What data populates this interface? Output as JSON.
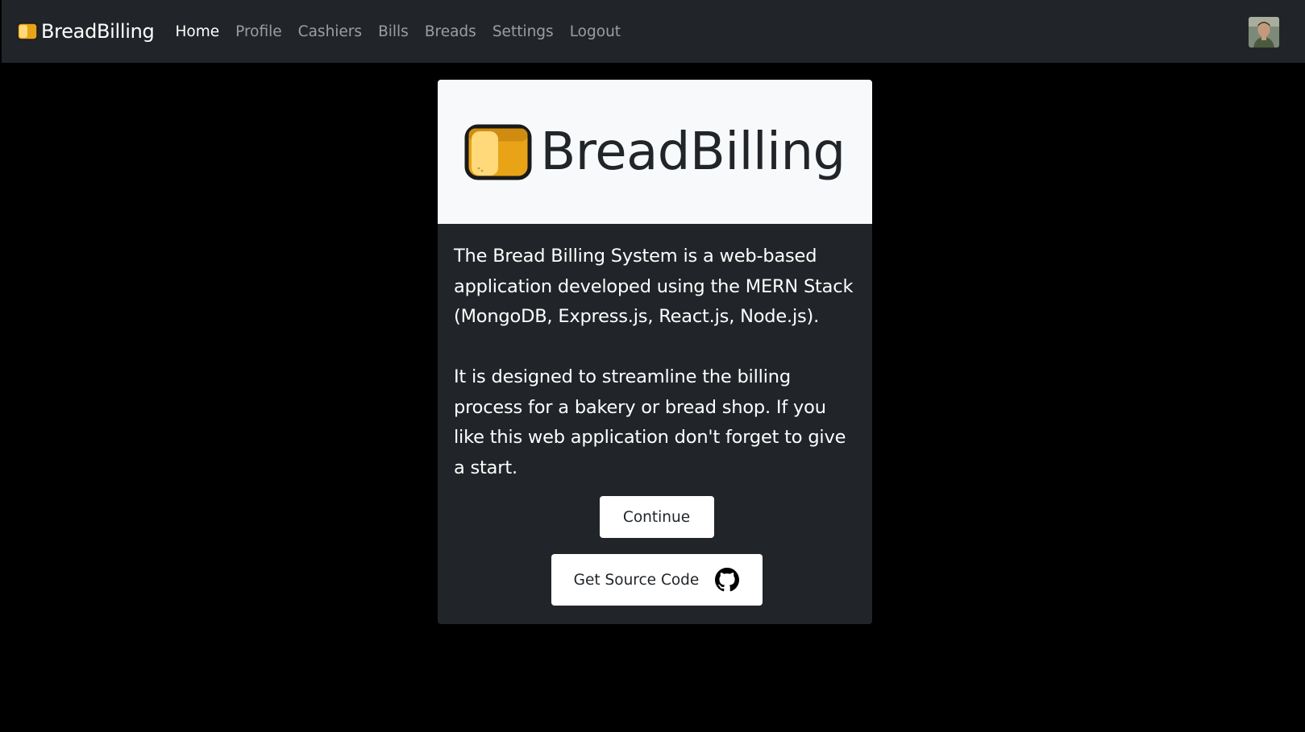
{
  "navbar": {
    "brand": "BreadBilling",
    "brand_icon": "bread-icon",
    "links": [
      {
        "label": "Home",
        "active": true
      },
      {
        "label": "Profile",
        "active": false
      },
      {
        "label": "Cashiers",
        "active": false
      },
      {
        "label": "Bills",
        "active": false
      },
      {
        "label": "Breads",
        "active": false
      },
      {
        "label": "Settings",
        "active": false
      },
      {
        "label": "Logout",
        "active": false
      }
    ],
    "avatar_icon": "user-avatar"
  },
  "card": {
    "logo_text": "BreadBilling",
    "logo_icon": "bread-icon",
    "paragraphs": [
      "The Bread Billing System is a web-based application developed using the MERN Stack (MongoDB, Express.js, React.js, Node.js).",
      "It is designed to streamline the billing process for a bakery or bread shop. If you like this web application don't forget to give a start."
    ],
    "continue_label": "Continue",
    "source_label": "Get Source Code",
    "source_icon": "github-icon"
  },
  "colors": {
    "navbar_bg": "#212529",
    "page_bg": "#000000",
    "card_header_bg": "#f8f9fa",
    "bread_crust": "#e8a317",
    "bread_inner": "#ffd97a"
  }
}
